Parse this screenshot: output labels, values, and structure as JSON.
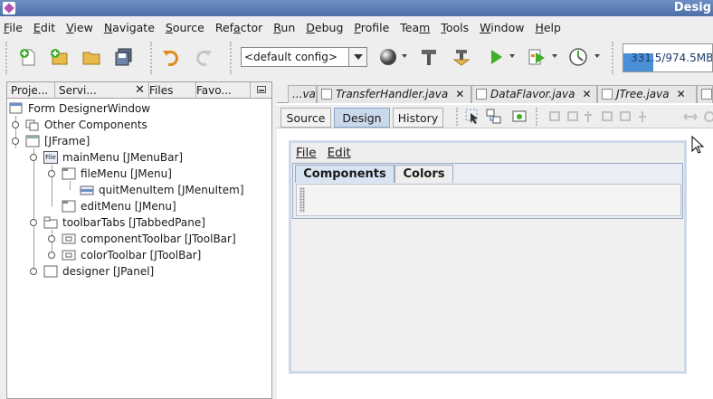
{
  "window": {
    "title": "Desig"
  },
  "menubar": [
    {
      "label": "File",
      "u": "F",
      "rest": "ile"
    },
    {
      "label": "Edit",
      "u": "E",
      "rest": "dit"
    },
    {
      "label": "View",
      "u": "V",
      "rest": "iew"
    },
    {
      "label": "Navigate",
      "u": "N",
      "rest": "avigate"
    },
    {
      "label": "Source",
      "u": "S",
      "rest": "ource"
    },
    {
      "label": "Refactor",
      "pre": "Ref",
      "u": "a",
      "rest": "ctor"
    },
    {
      "label": "Run",
      "u": "R",
      "rest": "un"
    },
    {
      "label": "Debug",
      "u": "D",
      "rest": "ebug"
    },
    {
      "label": "Profile",
      "u": "P",
      "rest": "rofile"
    },
    {
      "label": "Team",
      "pre": "Tea",
      "u": "m",
      "rest": ""
    },
    {
      "label": "Tools",
      "u": "T",
      "rest": "ools"
    },
    {
      "label": "Window",
      "u": "W",
      "rest": "indow"
    },
    {
      "label": "Help",
      "u": "H",
      "rest": "elp"
    }
  ],
  "toolbar": {
    "config": "<default config>",
    "memory": "331.5/974.5MB",
    "memory_used_fraction": 0.34
  },
  "left_tabs": [
    "Proje...",
    "Servi...",
    "Files",
    "Favo..."
  ],
  "tree": [
    {
      "label": "Form DesignerWindow",
      "level": 0,
      "icon": "form-icon"
    },
    {
      "label": "Other Components",
      "level": 1,
      "icon": "components-icon"
    },
    {
      "label": "[JFrame]",
      "level": 1,
      "icon": "frame-icon"
    },
    {
      "label": "mainMenu [JMenuBar]",
      "level": 2,
      "icon": "menubar-icon"
    },
    {
      "label": "fileMenu [JMenu]",
      "level": 3,
      "icon": "menu-icon"
    },
    {
      "label": "quitMenuItem [JMenuItem]",
      "level": 4,
      "icon": "menuitem-icon"
    },
    {
      "label": "editMenu [JMenu]",
      "level": 3,
      "icon": "menu-icon"
    },
    {
      "label": "toolbarTabs [JTabbedPane]",
      "level": 2,
      "icon": "tabbedpane-icon"
    },
    {
      "label": "componentToolbar [JToolBar]",
      "level": 3,
      "icon": "toolbar-icon"
    },
    {
      "label": "colorToolbar [JToolBar]",
      "level": 3,
      "icon": "toolbar-icon"
    },
    {
      "label": "designer [JPanel]",
      "level": 2,
      "icon": "panel-icon"
    }
  ],
  "menubar_icon_text": "File",
  "file_tabs": [
    "...va",
    "TransferHandler.java",
    "DataFlavor.java",
    "JTree.java"
  ],
  "view_buttons": [
    "Source",
    "Design",
    "History"
  ],
  "form": {
    "menus": [
      "File",
      "Edit"
    ],
    "tabs": [
      "Components",
      "Colors"
    ]
  },
  "colors": {
    "accent": "#4a90d8",
    "selected_tab": "#c9d8ea"
  }
}
